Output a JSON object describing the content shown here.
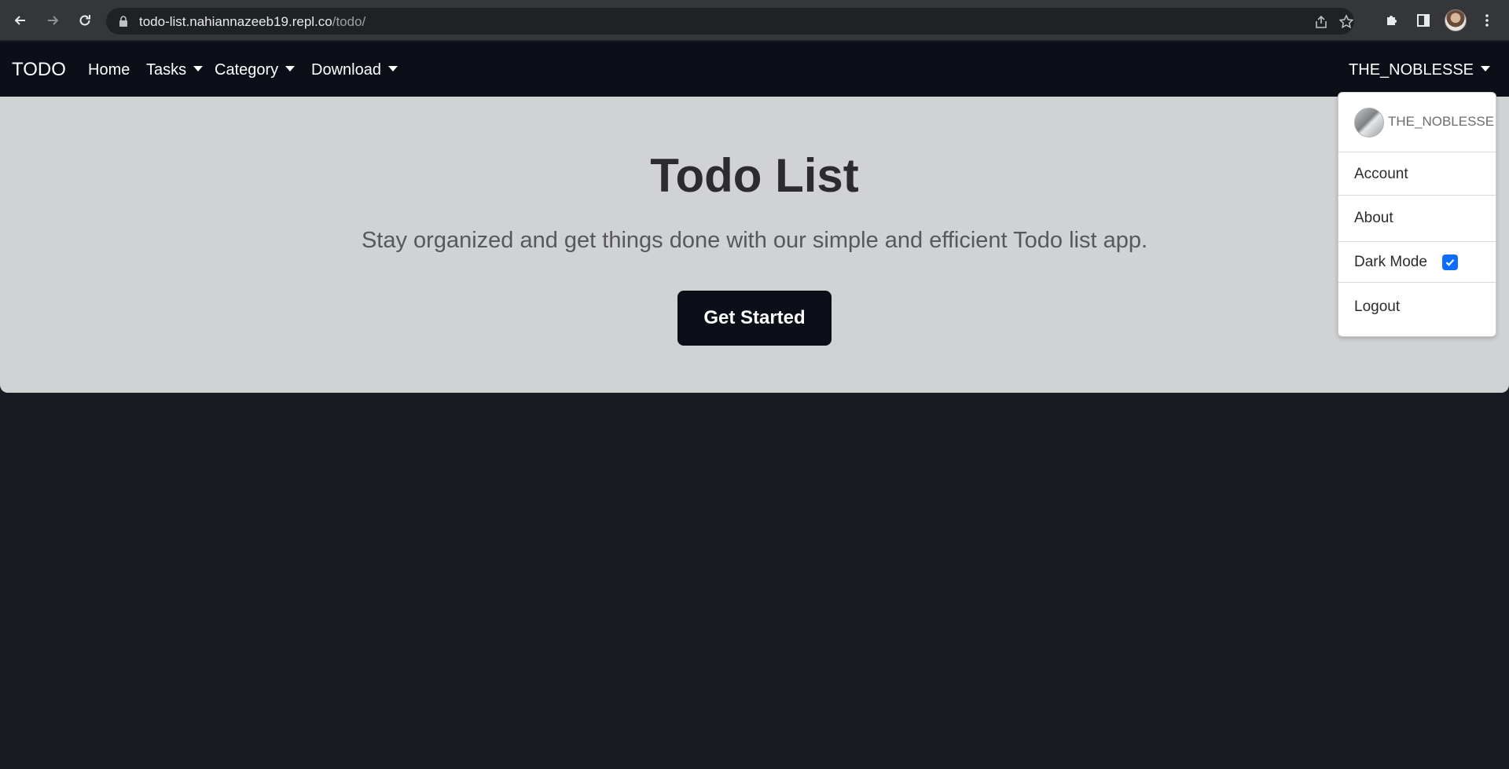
{
  "browser": {
    "url_host": "todo-list.nahiannazeeb19.repl.co",
    "url_path": "/todo/"
  },
  "navbar": {
    "brand": "TODO",
    "links": [
      {
        "label": "Home",
        "has_caret": false
      },
      {
        "label": "Tasks",
        "has_caret": true
      },
      {
        "label": "Category",
        "has_caret": true
      },
      {
        "label": "Download",
        "has_caret": true
      }
    ],
    "user": "THE_NOBLESSE"
  },
  "hero": {
    "title": "Todo List",
    "subtitle": "Stay organized and get things done with our simple and efficient Todo list app.",
    "button_label": "Get Started"
  },
  "dropdown": {
    "username": "THE_NOBLESSE",
    "items": {
      "account": "Account",
      "about": "About",
      "dark_mode": "Dark Mode",
      "logout": "Logout"
    },
    "dark_mode_checked": true
  },
  "colors": {
    "navbar_bg": "#0c0f17",
    "page_bg": "#181b22",
    "hero_bg": "#d1d2d4",
    "checkbox_accent": "#0d6efd"
  }
}
